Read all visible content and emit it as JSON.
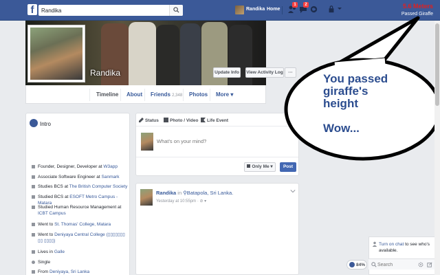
{
  "topbar": {
    "logo_letter": "f",
    "search_value": "Randika",
    "user_name": "Randika",
    "home_label": "Home",
    "friend_requests_badge": "1",
    "messages_badge": "2",
    "stat_value": "5.6 Meters",
    "stat_label": "Passed Giraffe",
    "bar_color": "#3b5998"
  },
  "profile": {
    "name": "Randika",
    "update_info_label": "Update Info",
    "activity_log_label": "View Activity Log",
    "more_dots": "···"
  },
  "tabs": [
    {
      "label": "Timeline"
    },
    {
      "label": "About"
    },
    {
      "label": "Friends",
      "count": "2,348"
    },
    {
      "label": "Photos"
    },
    {
      "label": "More ▾"
    }
  ],
  "intro": {
    "title": "Intro",
    "items": [
      {
        "text": "Founder, Designer, Developer at ",
        "link": "W3app"
      },
      {
        "text": "Associate Software Engineer at ",
        "link": "Sanmark"
      },
      {
        "text": "Studies BCS at ",
        "link": "The British Computer Society"
      },
      {
        "text": "Studied BCS at ",
        "link": "ESOFT Metro Campus - Matara"
      },
      {
        "text": "Studied Human Resource Management at ",
        "link": "ICBT Campus"
      },
      {
        "text": "Went to ",
        "link": "St. Thomas' College, Matara"
      },
      {
        "text": "Went to ",
        "link": "Deniyaya Central College (▯▯▯▯▯▯▯ ▯▯ ▯▯▯▯)"
      },
      {
        "text": "Lives in ",
        "link": "Galle"
      },
      {
        "text": "Single",
        "link": ""
      },
      {
        "text": "From ",
        "link": "Deniyaya, Sri Lanka"
      }
    ]
  },
  "composer": {
    "tab_status": "Status",
    "tab_photo": "Photo / Video",
    "tab_life": "Life Event",
    "placeholder": "What's on your mind?",
    "privacy_label": "Only Me ▾",
    "post_label": "Post"
  },
  "feed_post": {
    "author": "Randika",
    "in_word": "in",
    "place": "Batapola, Sri Lanka.",
    "time": "Yesterday at 10:55pm · ",
    "privacy_icon": "⊘ ▾"
  },
  "bubble": {
    "line1": "You passed",
    "line2": "giraffe's",
    "line3": "height",
    "line4": "Wow...",
    "stroke_color": "#000000",
    "text_color": "#2c4d8f"
  },
  "chat": {
    "turn_on_link": "Turn on chat",
    "turn_on_text": " to see who's available.",
    "search_placeholder": "Search",
    "zoom_label": "84%"
  }
}
